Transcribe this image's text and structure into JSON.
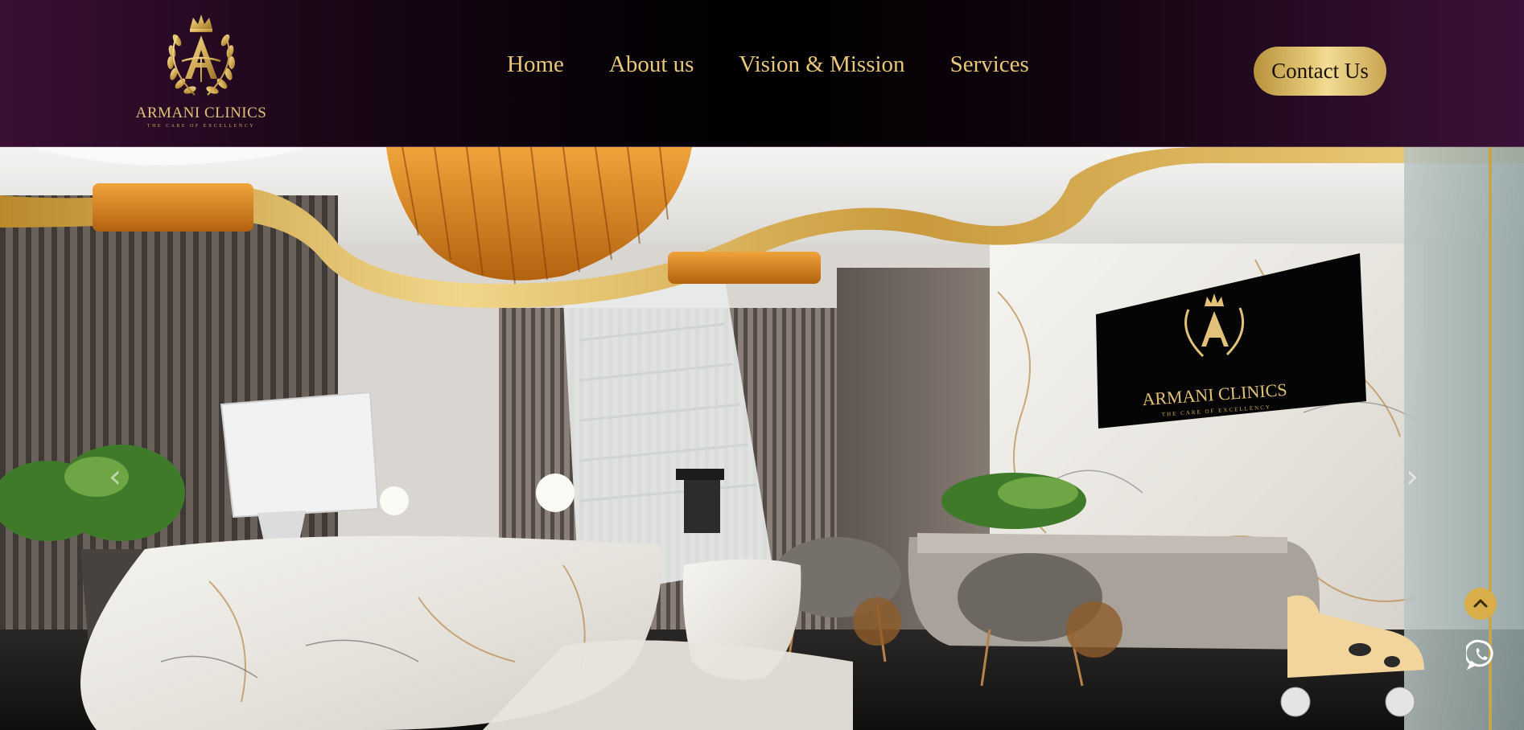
{
  "brand": {
    "name": "ARMANI CLINICS",
    "tagline": "THE CARE OF EXCELLENCY",
    "logo_letter": "A",
    "gold": "#e2c27a"
  },
  "nav": {
    "items": [
      {
        "label": "Home"
      },
      {
        "label": "About us"
      },
      {
        "label": "Vision & Mission"
      },
      {
        "label": "Services"
      }
    ]
  },
  "header": {
    "contact_label": "Contact Us"
  },
  "hero": {
    "image_description": "Luxury clinic reception interior",
    "sign_name": "ARMANI CLINICS",
    "sign_tagline": "THE CARE OF EXCELLENCY",
    "prev_glyph": "‹",
    "next_glyph": "›"
  },
  "floating": {
    "scroll_top_icon": "chevron-up-icon",
    "whatsapp_icon": "whatsapp-icon",
    "accent": "#d8ad4a"
  }
}
